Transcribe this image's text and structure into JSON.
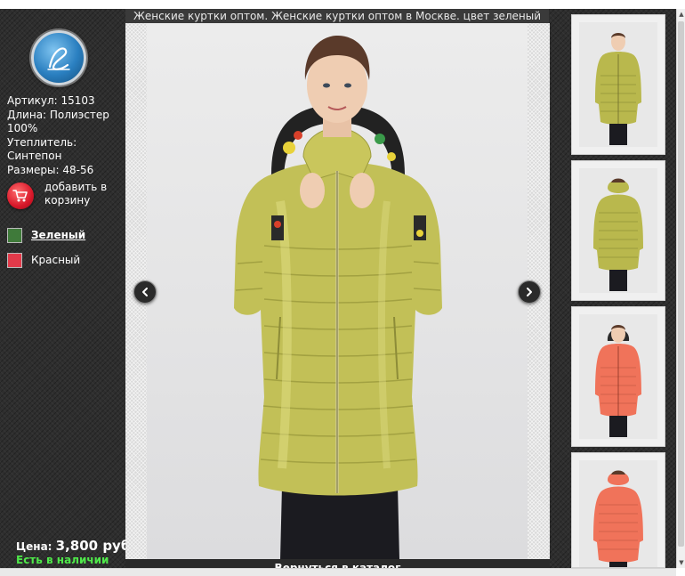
{
  "page": {
    "title": "Женские куртки оптом. Женские куртки оптом в Москве. цвет зеленый"
  },
  "product": {
    "article": "Артикул: 15103",
    "length_line1": "Длина: Полиэстер",
    "length_line2": "100%",
    "filling_label": "Утеплитель:",
    "filling_value": "Синтепон",
    "sizes": "Размеры: 48-56"
  },
  "cart": {
    "label_line1": "добавить в",
    "label_line2": "корзину",
    "icon": "cart-icon"
  },
  "colors": [
    {
      "name": "Зеленый",
      "swatch": "#3f7a3a",
      "selected": true
    },
    {
      "name": "Красный",
      "swatch": "#e23a4a",
      "selected": false
    }
  ],
  "price": {
    "label": "Цена:",
    "value": "3,800 руб."
  },
  "stock": {
    "text": "Есть в наличии",
    "color": "#4fe84a"
  },
  "navigation": {
    "back_to_catalog": "Вернуться в каталог",
    "prev_icon": "chevron-left-icon",
    "next_icon": "chevron-right-icon"
  },
  "thumbnails": [
    {
      "jacket_color": "#b9b84d",
      "view": "front"
    },
    {
      "jacket_color": "#b9b84d",
      "view": "back"
    },
    {
      "jacket_color": "#f0735a",
      "view": "front"
    },
    {
      "jacket_color": "#f0735a",
      "view": "back"
    }
  ],
  "colors_theme": {
    "panel_bg": "#2e2e2e",
    "jacket_main": "#c2c057",
    "accent_red": "#d8182a"
  }
}
